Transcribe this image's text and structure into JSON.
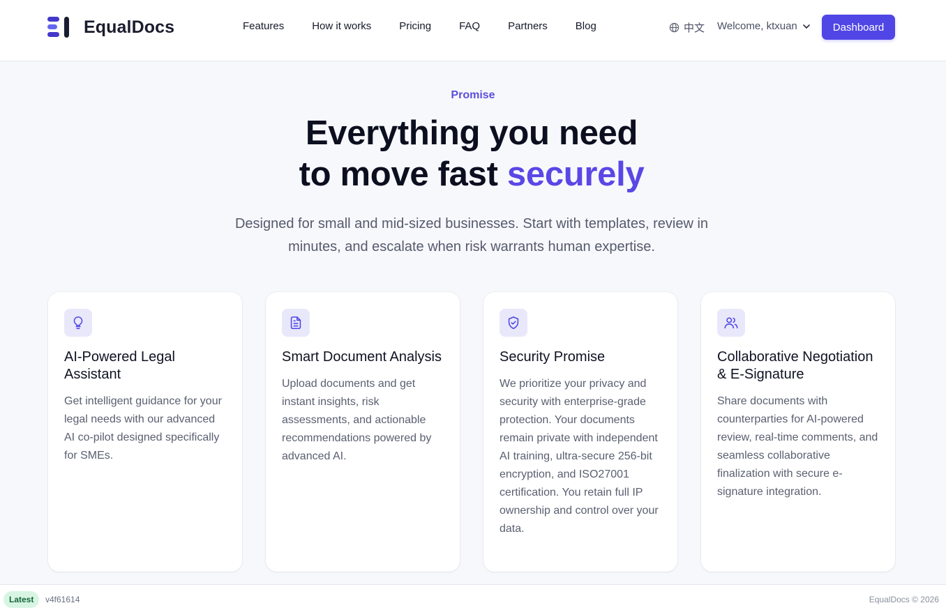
{
  "brand": {
    "name": "EqualDocs",
    "logo_icon": "equaldocs-logo-icon",
    "accent_color": "#5046e5"
  },
  "nav": {
    "items": [
      "Features",
      "How it works",
      "Pricing",
      "FAQ",
      "Partners",
      "Blog"
    ]
  },
  "header": {
    "language": "中文",
    "welcome": "Welcome, ktxuan",
    "dashboard_label": "Dashboard"
  },
  "hero": {
    "eyebrow": "Promise",
    "headline_line1": "Everything you need",
    "headline_line2_prefix": "to move fast ",
    "headline_line2_accent": "securely",
    "subtitle_line1": "Designed for small and mid-sized businesses. Start with templates, review in",
    "subtitle_line2": "minutes, and escalate when risk warrants human expertise."
  },
  "cards": [
    {
      "icon": "lightbulb-icon",
      "title": "AI-Powered Legal Assistant",
      "text": "Get intelligent guidance for your legal needs with our advanced AI co-pilot designed specifically for SMEs."
    },
    {
      "icon": "document-icon",
      "title": "Smart Document Analysis",
      "text": "Upload documents and get instant insights, risk assessments, and actionable recommendations powered by advanced AI."
    },
    {
      "icon": "shield-check-icon",
      "title": "Security Promise",
      "text": "We prioritize your privacy and security with enterprise-grade protection. Your documents remain private with independent AI training, ultra-secure 256-bit encryption, and ISO27001 certification. You retain full IP ownership and control over your data."
    },
    {
      "icon": "users-icon",
      "title": "Collaborative Negotiation & E-Signature",
      "text": "Share documents with counterparties for AI-powered review, real-time comments, and seamless collaborative finalization with secure e-signature integration."
    }
  ],
  "footer": {
    "badge": "Latest",
    "version": "v4f61614",
    "copyright": "EqualDocs © 2026"
  }
}
